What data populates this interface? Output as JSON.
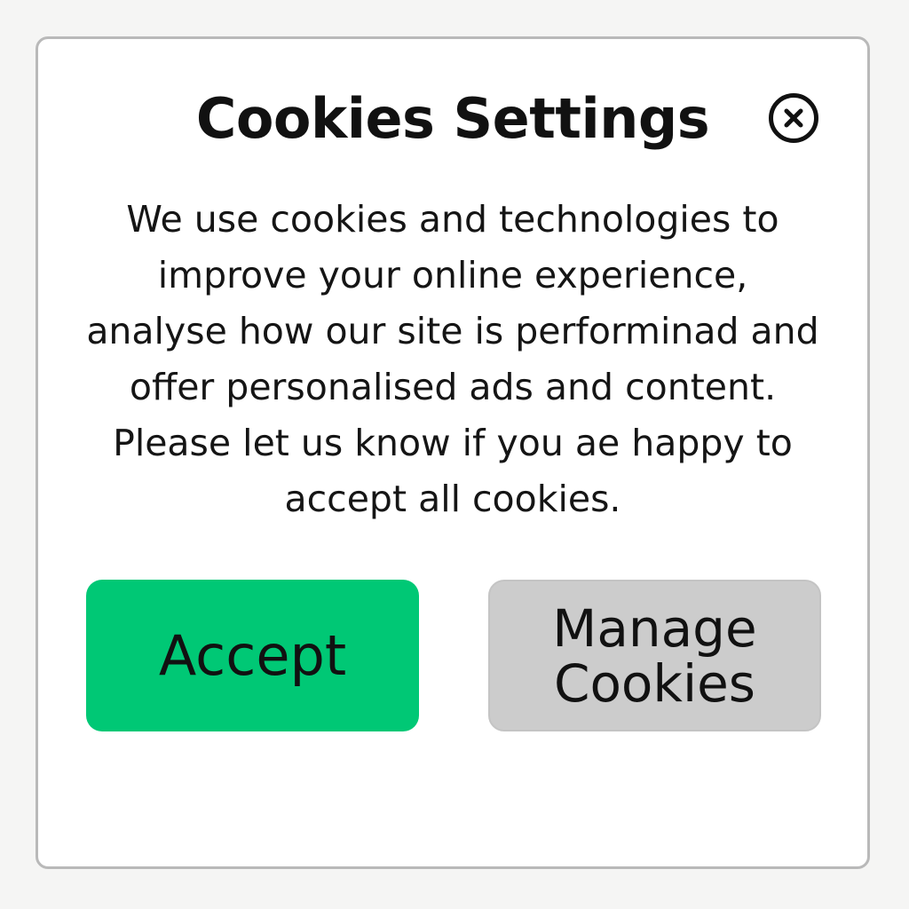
{
  "dialog": {
    "title": "Cookies Settings",
    "close_icon": "close-circle-icon",
    "message": "We use cookies and technologies to improve your online experience, analyse how our site is performinad and offer personalised ads and content. Please let us know if you ae happy to accept all cookies.",
    "accept_label": "Accept",
    "manage_label": "Manage Cookies"
  },
  "colors": {
    "accept_button": "#00c875",
    "manage_button": "#cccccc",
    "dialog_border": "#b9b9b9",
    "text": "#111111"
  }
}
